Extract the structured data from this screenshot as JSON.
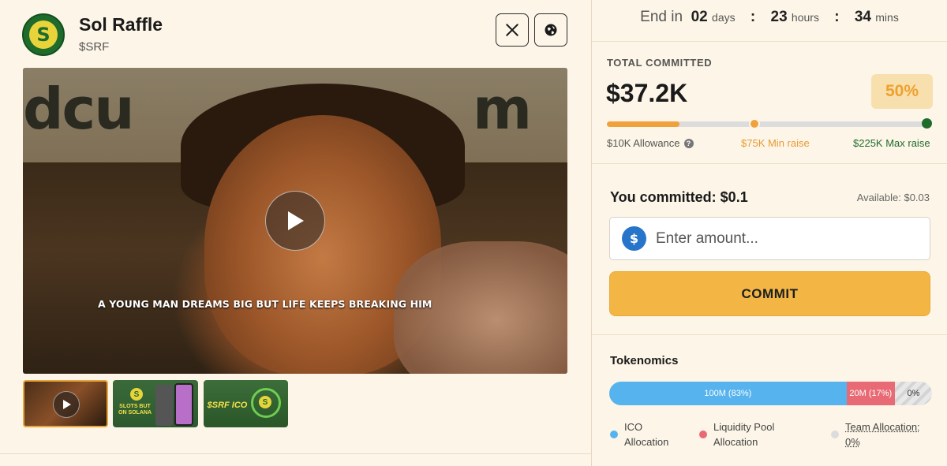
{
  "project": {
    "logo_letter": "S",
    "name": "Sol Raffle",
    "ticker": "$SRF"
  },
  "video": {
    "caption": "A YOUNG MAN DREAMS BIG  BUT LIFE KEEPS BREAKING HIM",
    "wall_text_left": "dcu",
    "wall_text_right": "m"
  },
  "thumbnails": [
    {
      "label": ""
    },
    {
      "label": "SLOTS BUT ON SOLANA"
    },
    {
      "label": "$SRF ICO"
    }
  ],
  "timer": {
    "prefix": "End in",
    "days": "02",
    "days_unit": "days",
    "hours": "23",
    "hours_unit": "hours",
    "mins": "34",
    "mins_unit": "mins",
    "separator": ":"
  },
  "commit_stats": {
    "label": "TOTAL COMMITTED",
    "amount": "$37.2K",
    "percent": "50%",
    "progress_fraction": 0.228,
    "allowance_label": "$10K Allowance",
    "min_label": "$75K Min raise",
    "max_label": "$225K Max raise",
    "help_glyph": "?"
  },
  "commit_form": {
    "committed_label": "You committed: $0.1",
    "available_label": "Available: $0.03",
    "input_placeholder": "Enter amount...",
    "button_label": "COMMIT",
    "token_glyph": "$"
  },
  "tokenomics": {
    "title": "Tokenomics",
    "segments": [
      {
        "label": "100M (83%)",
        "percent": 73.5
      },
      {
        "label": "20M (17%)",
        "percent": 15
      },
      {
        "label": "0%",
        "percent": 11.5
      }
    ],
    "legend": [
      {
        "line1": "ICO",
        "line2": "Allocation",
        "color": "#56b3ee"
      },
      {
        "line1": "Liquidity Pool",
        "line2": "Allocation",
        "color": "#e86a75"
      },
      {
        "line1": "Team Allocation:",
        "line2": "0%",
        "color": "#dcdcdc"
      }
    ]
  },
  "colors": {
    "accent": "#f3b645",
    "brand_green": "#1f6b2c",
    "background": "#fdf6e8"
  }
}
